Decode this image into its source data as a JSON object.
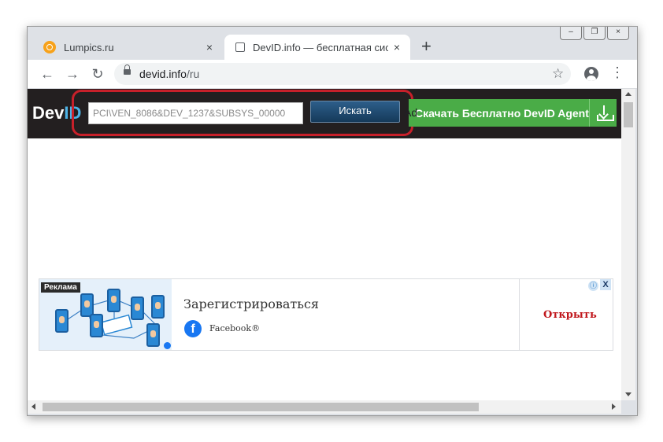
{
  "browser": {
    "tabs": [
      {
        "title": "Lumpics.ru",
        "favicon": "lumpics-favicon",
        "close": "×"
      },
      {
        "title": "DevID.info — бесплатная систем",
        "favicon": "page-icon",
        "close": "×"
      }
    ],
    "new_tab": "+",
    "window_controls": {
      "minimize": "–",
      "restore": "❐",
      "close": "×"
    },
    "nav": {
      "back": "←",
      "forward": "→",
      "reload": "↻"
    },
    "url_domain": "devid.info",
    "url_path": "/ru",
    "bookmark": "☆",
    "menu": "⋮"
  },
  "site": {
    "logo_dev": "Dev",
    "logo_id": "ID",
    "search_value": "PCI\\VEN_8086&DEV_1237&SUBSYS_00000",
    "search_button": "Искать",
    "download_label": "Скачать Бесплатно DevID Agent",
    "ad_label": "Ad",
    "accent_color": "#4aac47",
    "highlight_color": "#c8202a"
  },
  "fb_ad": {
    "badge": "Реклама",
    "headline": "Зарегистрироваться",
    "brand": "Facebook®",
    "fb_letter": "f",
    "cta": "Открыть",
    "adchoices_icon": "ⓘ",
    "close": "X"
  }
}
